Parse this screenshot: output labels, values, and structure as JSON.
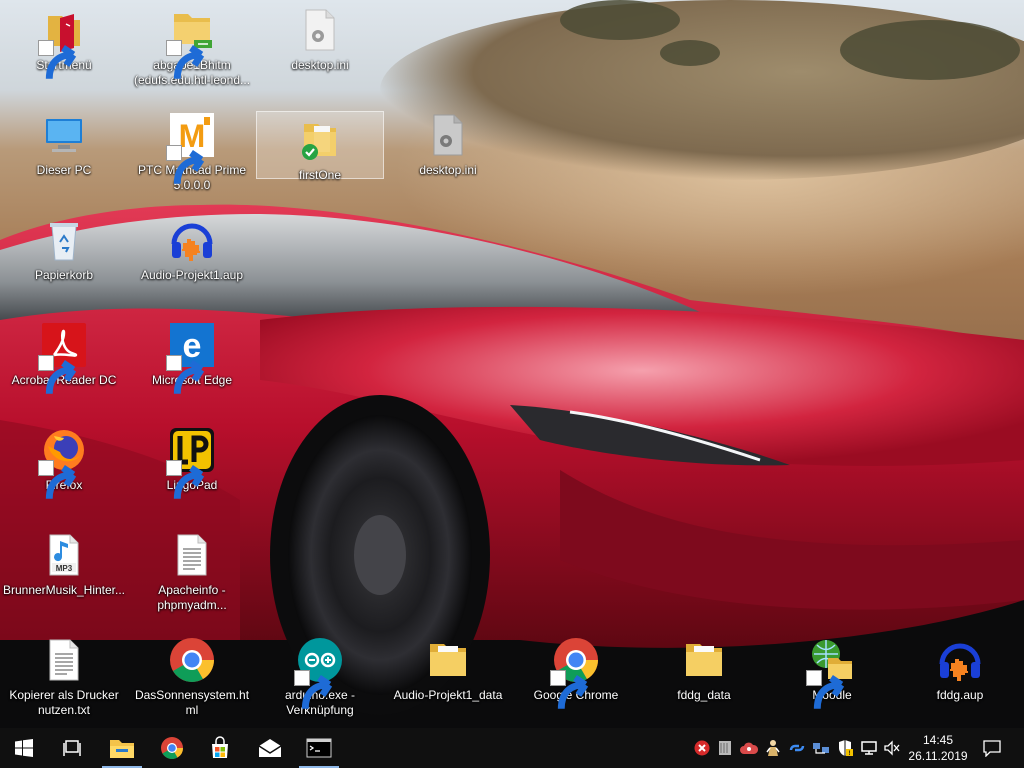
{
  "desktop": {
    "icons": [
      {
        "label": "Startmenü",
        "icon": "startmenu-folder-icon",
        "shortcut": true
      },
      {
        "label": "abgabe1Bhitm (edufs.edu.htl-leond...",
        "icon": "network-folder-icon",
        "shortcut": true
      },
      {
        "label": "desktop.ini",
        "icon": "ini-file-icon",
        "shortcut": false
      },
      {
        "label": "Dieser PC",
        "icon": "computer-icon",
        "shortcut": false
      },
      {
        "label": "PTC Mathcad Prime 5.0.0.0",
        "icon": "mathcad-icon",
        "shortcut": true
      },
      {
        "label": "firstOne",
        "icon": "synced-folder-icon",
        "shortcut": false
      },
      {
        "label": "desktop.ini",
        "icon": "ini-file-icon",
        "shortcut": false
      },
      {
        "label": "Papierkorb",
        "icon": "recycle-bin-icon",
        "shortcut": false
      },
      {
        "label": "Audio-Projekt1.aup",
        "icon": "audacity-icon",
        "shortcut": false
      },
      {
        "label": "Acrobat Reader DC",
        "icon": "acrobat-icon",
        "shortcut": true
      },
      {
        "label": "Microsoft Edge",
        "icon": "edge-icon",
        "shortcut": true
      },
      {
        "label": "Firefox",
        "icon": "firefox-icon",
        "shortcut": true
      },
      {
        "label": "LingoPad",
        "icon": "lingopad-icon",
        "shortcut": true
      },
      {
        "label": "BrunnerMusik_Hinter...",
        "icon": "mp3-file-icon",
        "shortcut": false
      },
      {
        "label": "Apacheinfo - phpmyadm...",
        "icon": "text-file-icon",
        "shortcut": false
      },
      {
        "label": "Kopierer als Drucker nutzen.txt",
        "icon": "text-file-icon",
        "shortcut": false
      },
      {
        "label": "DasSonnensystem.html",
        "icon": "chrome-icon",
        "shortcut": false
      },
      {
        "label": "arduino.exe - Verknüpfung",
        "icon": "arduino-icon",
        "shortcut": true
      },
      {
        "label": "Audio-Projekt1_data",
        "icon": "folder-icon",
        "shortcut": false
      },
      {
        "label": "Google Chrome",
        "icon": "chrome-icon",
        "shortcut": true
      },
      {
        "label": "fddg_data",
        "icon": "folder-icon",
        "shortcut": false
      },
      {
        "label": "Moodle",
        "icon": "moodle-icon",
        "shortcut": true
      },
      {
        "label": "fddg.aup",
        "icon": "audacity-icon",
        "shortcut": false
      }
    ]
  },
  "taskbar": {
    "pinned": [
      {
        "icon": "windows-start-icon"
      },
      {
        "icon": "task-view-icon"
      },
      {
        "icon": "file-explorer-icon",
        "active": true
      },
      {
        "icon": "chrome-icon"
      },
      {
        "icon": "microsoft-store-icon"
      },
      {
        "icon": "mail-icon"
      },
      {
        "icon": "command-prompt-icon"
      }
    ],
    "tray": [
      "error-status-icon",
      "storage-icon",
      "cloud-status-icon",
      "user-figure-icon",
      "bluetooth-link-icon",
      "network-share-icon",
      "security-shield-icon",
      "network-icon",
      "volume-muted-icon"
    ],
    "clock": {
      "time": "14:45",
      "date": "26.11.2019"
    },
    "notification_icon": "action-center-icon"
  }
}
